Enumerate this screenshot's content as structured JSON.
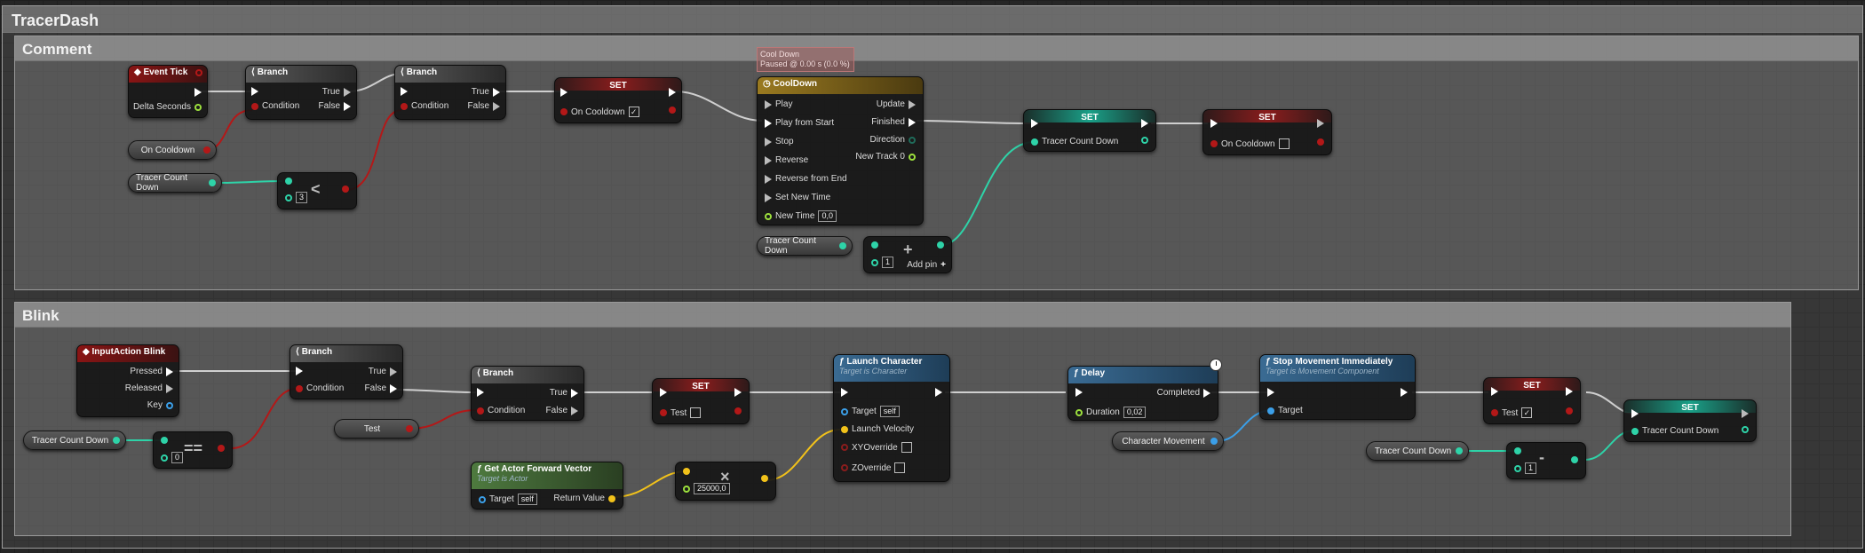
{
  "graph": {
    "title": "TracerDash",
    "comments": [
      {
        "title": "Comment"
      },
      {
        "title": "Blink"
      }
    ]
  },
  "nodes": {
    "event_tick": {
      "title": "Event Tick",
      "delta": "Delta Seconds"
    },
    "branch1": {
      "title": "Branch",
      "true": "True",
      "false": "False",
      "condition": "Condition"
    },
    "branch2": {
      "title": "Branch",
      "true": "True",
      "false": "False",
      "condition": "Condition"
    },
    "set_oncooldown_1": {
      "title": "SET",
      "pin": "On Cooldown",
      "checked": "✓"
    },
    "less": {
      "op": "<",
      "value": "3"
    },
    "timeline": {
      "title": "CoolDown",
      "status_line1": "Cool Down",
      "status_line2": "Paused @ 0.00 s (0.0 %)",
      "inputs": [
        "Play",
        "Play from Start",
        "Stop",
        "Reverse",
        "Reverse from End",
        "Set New Time",
        "New Time"
      ],
      "new_time_value": "0,0",
      "outputs": [
        "Update",
        "Finished",
        "Direction",
        "New Track 0"
      ]
    },
    "set_tracer_1": {
      "title": "SET",
      "pin": "Tracer Count Down"
    },
    "set_oncooldown_2": {
      "title": "SET",
      "pin": "On Cooldown"
    },
    "add": {
      "op": "+",
      "value": "1",
      "add_pin": "Add pin"
    },
    "input_blink": {
      "title": "InputAction Blink",
      "pressed": "Pressed",
      "released": "Released",
      "key": "Key"
    },
    "equal": {
      "op": "==",
      "value": "0"
    },
    "branch3": {
      "title": "Branch",
      "true": "True",
      "false": "False",
      "condition": "Condition"
    },
    "branch4": {
      "title": "Branch",
      "true": "True",
      "false": "False",
      "condition": "Condition"
    },
    "set_test_1": {
      "title": "SET",
      "pin": "Test"
    },
    "get_forward": {
      "title": "Get Actor Forward Vector",
      "subtitle": "Target is Actor",
      "target": "Target",
      "target_value": "self",
      "ret": "Return Value"
    },
    "multiply": {
      "op": "×",
      "value": "25000,0"
    },
    "launch": {
      "title": "Launch Character",
      "subtitle": "Target is Character",
      "target": "Target",
      "target_value": "self",
      "velocity": "Launch Velocity",
      "xy": "XYOverride",
      "z": "ZOverride"
    },
    "delay": {
      "title": "Delay",
      "duration": "Duration",
      "duration_value": "0,02",
      "completed": "Completed"
    },
    "stop_movement": {
      "title": "Stop Movement Immediately",
      "subtitle": "Target is Movement Component",
      "target": "Target"
    },
    "set_test_2": {
      "title": "SET",
      "pin": "Test",
      "checked": "✓"
    },
    "set_tracer_2": {
      "title": "SET",
      "pin": "Tracer Count Down"
    },
    "minus": {
      "op": "-",
      "value": "1"
    }
  },
  "variables": {
    "on_cooldown": "On Cooldown",
    "tracer_count_down_a": "Tracer Count Down",
    "tracer_count_down_b": "Tracer Count Down",
    "tracer_count_down_c": "Tracer Count Down",
    "tracer_count_down_d": "Tracer Count Down",
    "test": "Test",
    "character_movement": "Character Movement"
  },
  "colors": {
    "exec": "#ffffff",
    "bool": "#b31818",
    "int": "#2ed3a8",
    "float": "#9ce03d",
    "object": "#3b9fe8",
    "vector": "#f2c21a"
  }
}
